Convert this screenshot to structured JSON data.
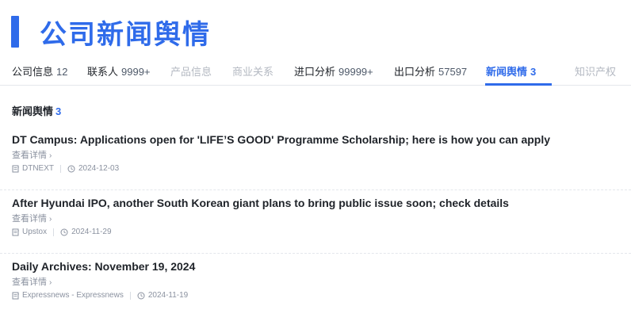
{
  "page": {
    "title": "公司新闻舆情",
    "accent_color": "#2f6bea"
  },
  "tabs": [
    {
      "label": "公司信息",
      "count": "12",
      "state": "normal"
    },
    {
      "label": "联系人",
      "count": "9999+",
      "state": "normal"
    },
    {
      "label": "产品信息",
      "count": "",
      "state": "disabled"
    },
    {
      "label": "商业关系",
      "count": "",
      "state": "disabled"
    },
    {
      "label": "进口分析",
      "count": "99999+",
      "state": "normal"
    },
    {
      "label": "出口分析",
      "count": "57597",
      "state": "normal"
    },
    {
      "label": "新闻舆情",
      "count": "3",
      "state": "active"
    },
    {
      "label": "知识产权",
      "count": "",
      "state": "disabled"
    }
  ],
  "section": {
    "heading": "新闻舆情",
    "count": "3"
  },
  "news": [
    {
      "title": "DT Campus: Applications open for 'LIFE’S GOOD' Programme Scholarship; here is how you can apply",
      "detail_label": "查看详情",
      "source": "DTNEXT",
      "date": "2024-12-03"
    },
    {
      "title": "After Hyundai IPO, another South Korean giant plans to bring public issue soon; check details",
      "detail_label": "查看详情",
      "source": "Upstox",
      "date": "2024-11-29"
    },
    {
      "title": "Daily Archives: November 19, 2024",
      "detail_label": "查看详情",
      "source": "Expressnews - Expressnews",
      "date": "2024-11-19"
    }
  ],
  "icons": {
    "source": "newspaper-icon",
    "date": "clock-icon",
    "detail": "chevron-right-icon"
  }
}
